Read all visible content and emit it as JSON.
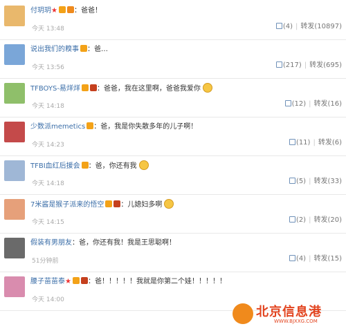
{
  "comments": [
    {
      "user": "付玥玥",
      "badges": [
        "star",
        "v",
        "m"
      ],
      "content": "：爸爸！",
      "time": "今天 13:48",
      "likes": "(4)",
      "repost": "转发(10897)"
    },
    {
      "user": "说出我们的糗事",
      "badges": [
        "v"
      ],
      "content": "：爸…",
      "time": "今天 13:56",
      "likes": "(217)",
      "repost": "转发(695)"
    },
    {
      "user": "TFBOYS-易烊烊",
      "badges": [
        "v",
        "c"
      ],
      "content": "：爸爸，我在这里啊，爸爸我爱你",
      "time": "今天 14:18",
      "likes": "(12)",
      "repost": "转发(16)"
    },
    {
      "user": "少数派memetics",
      "badges": [
        "v"
      ],
      "content": "：爸，我是你失散多年的儿子啊！",
      "time": "今天 14:23",
      "likes": "(11)",
      "repost": "转发(6)"
    },
    {
      "user": "TFBI血红后援会",
      "badges": [
        "v"
      ],
      "content": "：爸，你还有我",
      "time": "今天 14:18",
      "likes": "(5)",
      "repost": "转发(33)"
    },
    {
      "user": "7米酱是猴子派来的悟空",
      "badges": [
        "v",
        "c"
      ],
      "content": "：儿媳妇多啊",
      "time": "今天 14:15",
      "likes": "(2)",
      "repost": "转发(20)"
    },
    {
      "user": "假装有男朋友",
      "badges": [],
      "content": "：爸，你还有我！我是王思聪啊！",
      "time": "51分钟前",
      "likes": "(4)",
      "repost": "转发(15)"
    },
    {
      "user": "腰子苗苗泰",
      "badges": [
        "star",
        "v",
        "c"
      ],
      "content": "：爸！！！！！我就是你第二个娃！！！！！",
      "time": "今天 14:00",
      "likes": "",
      "repost": ""
    }
  ],
  "watermark": {
    "text": "北京信息港",
    "url": "WWW.BJXXG.COM"
  },
  "colors": {
    "username": "#3b6ea8",
    "time": "#a9a9a9",
    "watermark": "#e2431e"
  }
}
